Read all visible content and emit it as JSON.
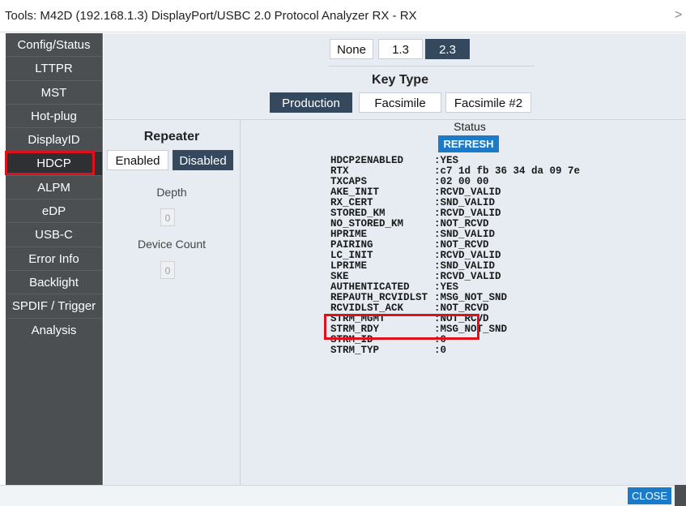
{
  "window": {
    "title": "Tools: M42D (192.168.1.3) DisplayPort/USBC 2.0 Protocol Analyzer RX - RX",
    "close_glyph": ">"
  },
  "sidebar": {
    "items": [
      {
        "label": "Config/Status"
      },
      {
        "label": "LTTPR"
      },
      {
        "label": "MST"
      },
      {
        "label": "Hot-plug"
      },
      {
        "label": "DisplayID"
      },
      {
        "label": "HDCP",
        "active": true
      },
      {
        "label": "ALPM"
      },
      {
        "label": "eDP"
      },
      {
        "label": "USB-C"
      },
      {
        "label": "Error Info"
      },
      {
        "label": "Backlight"
      },
      {
        "label": "SPDIF / Trigger"
      },
      {
        "label": "Analysis"
      }
    ]
  },
  "version": {
    "options": [
      "None",
      "1.3",
      "2.3"
    ],
    "selected": "2.3"
  },
  "key_type": {
    "title": "Key Type",
    "options": [
      "Production",
      "Facsimile",
      "Facsimile #2"
    ],
    "selected": "Production"
  },
  "repeater": {
    "title": "Repeater",
    "enabled_label": "Enabled",
    "disabled_label": "Disabled",
    "selected": "Disabled",
    "depth_label": "Depth",
    "depth_value": "0",
    "device_count_label": "Device Count",
    "device_count_value": "0"
  },
  "status": {
    "title": "Status",
    "refresh_label": "REFRESH",
    "rows": [
      {
        "key": "HDCP2ENABLED",
        "value": ":YES"
      },
      {
        "key": "RTX",
        "value": ":c7 1d fb 36 34 da 09 7e"
      },
      {
        "key": "TXCAPS",
        "value": ":02 00 00"
      },
      {
        "key": "AKE_INIT",
        "value": ":RCVD_VALID"
      },
      {
        "key": "RX_CERT",
        "value": ":SND_VALID"
      },
      {
        "key": "STORED_KM",
        "value": ":RCVD_VALID"
      },
      {
        "key": "NO_STORED_KM",
        "value": ":NOT_RCVD"
      },
      {
        "key": "HPRIME",
        "value": ":SND_VALID"
      },
      {
        "key": "PAIRING",
        "value": ":NOT_RCVD"
      },
      {
        "key": "LC_INIT",
        "value": ":RCVD_VALID"
      },
      {
        "key": "LPRIME",
        "value": ":SND_VALID"
      },
      {
        "key": "SKE",
        "value": ":RCVD_VALID"
      },
      {
        "key": "AUTHENTICATED",
        "value": ":YES"
      },
      {
        "key": "REPAUTH_RCVIDLST",
        "value": ":MSG_NOT_SND"
      },
      {
        "key": "RCVIDLST_ACK",
        "value": ":NOT_RCVD"
      },
      {
        "key": "STRM_MGMT",
        "value": ":NOT_RCVD"
      },
      {
        "key": "STRM_RDY",
        "value": ":MSG_NOT_SND"
      },
      {
        "key": "STRM_ID",
        "value": ":0"
      },
      {
        "key": "STRM_TYP",
        "value": ":0"
      }
    ]
  },
  "footer": {
    "close_label": "CLOSE"
  },
  "colors": {
    "sidebar_bg": "#4b4f52",
    "selected_button": "#34495e",
    "accent_blue": "#1c7bc8",
    "highlight_red": "#e0101a",
    "panel_bg": "#e6ecf2"
  }
}
